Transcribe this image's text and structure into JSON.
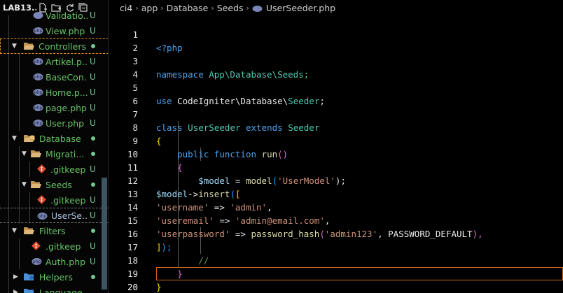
{
  "sidebar": {
    "title": "LAB13...",
    "actions": [
      "new-file-icon",
      "new-folder-icon",
      "refresh-icon",
      "collapse-all-icon"
    ],
    "rows": [
      {
        "label": "Validatio...",
        "status": "U",
        "type": "file"
      },
      {
        "label": "View.php",
        "status": "U",
        "type": "file"
      },
      {
        "label": "Controllers",
        "status": "dot",
        "type": "folder-open"
      },
      {
        "label": "Artikel.p...",
        "status": "U",
        "type": "file"
      },
      {
        "label": "BaseCon...",
        "status": "U",
        "type": "file"
      },
      {
        "label": "Home.p...",
        "status": "U",
        "type": "file"
      },
      {
        "label": "page.php",
        "status": "U",
        "type": "file"
      },
      {
        "label": "User.php",
        "status": "U",
        "type": "file"
      },
      {
        "label": "Database",
        "status": "dot",
        "type": "folder-open"
      },
      {
        "label": "Migrati...",
        "status": "dot",
        "type": "folder-open"
      },
      {
        "label": ".gitkeep",
        "status": "U",
        "type": "git"
      },
      {
        "label": "Seeds",
        "status": "dot",
        "type": "folder-open"
      },
      {
        "label": ".gitkeep",
        "status": "U",
        "type": "git"
      },
      {
        "label": "UserSe...",
        "status": "U",
        "type": "php"
      },
      {
        "label": "Filters",
        "status": "dot",
        "type": "folder-open"
      },
      {
        "label": ".gitkeep",
        "status": "U",
        "type": "git"
      },
      {
        "label": "Auth.php",
        "status": "U",
        "type": "file"
      },
      {
        "label": "Helpers",
        "status": "dot",
        "type": "folder-closed"
      },
      {
        "label": "Language",
        "status": "",
        "type": "folder-closed"
      }
    ]
  },
  "breadcrumb": [
    "ci4",
    "app",
    "Database",
    "Seeds",
    "UserSeeder.php"
  ],
  "editor": {
    "current_line": 20,
    "lines": [
      {
        "n": "1"
      },
      {
        "n": "2"
      },
      {
        "n": "3"
      },
      {
        "n": "4"
      },
      {
        "n": "5"
      },
      {
        "n": "6"
      },
      {
        "n": "7"
      },
      {
        "n": "8"
      },
      {
        "n": "9"
      },
      {
        "n": "10"
      },
      {
        "n": "11"
      },
      {
        "n": "12"
      },
      {
        "n": "13"
      },
      {
        "n": "14"
      },
      {
        "n": "15"
      },
      {
        "n": "16"
      },
      {
        "n": "17"
      },
      {
        "n": "18"
      },
      {
        "n": "19"
      },
      {
        "n": "20"
      }
    ],
    "tokens": {
      "l1": "<?php",
      "l3_kw": "namespace",
      "l3_ns": "App\\Database\\Seeds;",
      "l5_kw": "use",
      "l5_ns1": "CodeIgniter\\Database\\",
      "l5_ns2": "Seeder",
      "l5_semi": ";",
      "l7_kw": "class",
      "l7_cls": "UserSeeder",
      "l7_ext": "extends",
      "l7_base": "Seeder",
      "l8_brace": "{",
      "l9_pub": "public",
      "l9_fn": "function",
      "l9_name": "run",
      "l9_parens": "()",
      "l10_brace": "{",
      "l11_var": "$model",
      "l11_eq": " = ",
      "l11_fn": "model",
      "l11_open": "(",
      "l11_str": "'UserModel'",
      "l11_close": ");",
      "l12_var": "$model",
      "l12_arrow": "->",
      "l12_fn": "insert",
      "l12_open": "(",
      "l12_bracket": "[",
      "l13_key": "'username'",
      "l13_arrow": " => ",
      "l13_val": "'admin'",
      "l13_comma": ",",
      "l14_key": "'useremail'",
      "l14_arrow": " => ",
      "l14_val": "'admin@email.com'",
      "l14_comma": ",",
      "l15_key": "'userpassword'",
      "l15_arrow": " => ",
      "l15_fn": "password_hash",
      "l15_open": "(",
      "l15_str": "'admin123'",
      "l15_rest": ", PASSWORD_DEFAULT",
      "l15_close": "),",
      "l16_bracket": "]",
      "l16_close": ");",
      "l17_cm": "//",
      "l18_brace": "}",
      "l19_brace": "}"
    }
  },
  "colors": {
    "git_status": "#73c991",
    "folder": "#dcb67a",
    "highlight_border": "#c9651a"
  }
}
